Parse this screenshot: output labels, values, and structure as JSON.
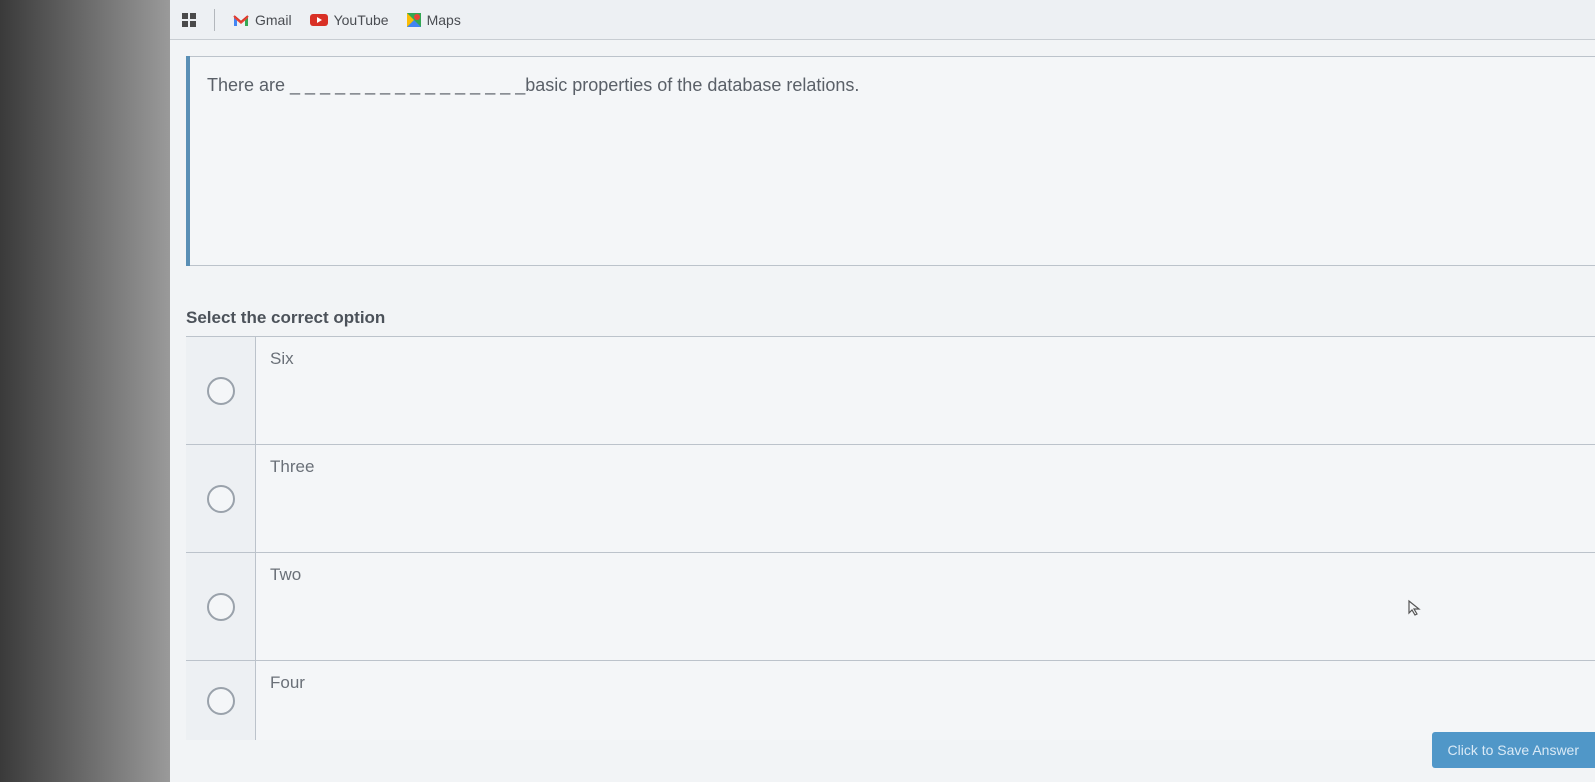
{
  "bookmarks": {
    "gmail": "Gmail",
    "youtube": "YouTube",
    "maps": "Maps"
  },
  "question": {
    "text": "There are _ _ _ _ _ _ _ _ _ _ _ _ _ _ _ _basic properties of the database relations."
  },
  "instruction": "Select the correct option",
  "options": [
    {
      "label": "Six"
    },
    {
      "label": "Three"
    },
    {
      "label": "Two"
    },
    {
      "label": "Four"
    }
  ],
  "save_button": "Click to Save Answer"
}
